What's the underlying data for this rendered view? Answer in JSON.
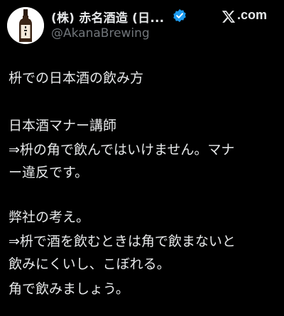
{
  "account": {
    "display_name": "(株) 赤名酒造 (日...",
    "handle": "@AkanaBrewing",
    "verified": true,
    "avatar_icon": "sake-bottle-icon",
    "verified_icon": "verified-badge-icon",
    "verified_color": "#1d9bf0"
  },
  "brand": {
    "logo_icon": "x-logo-icon",
    "logo_text": ".com"
  },
  "post": {
    "lines": [
      "枡での日本酒の飲み方",
      "日本酒マナー講師",
      "⇒枡の角で飲んではいけません。マナ",
      "ー違反です。",
      "弊社の考え。",
      "⇒枡で酒を飲むときは角で飲まないと",
      "飲みにくいし、こぼれる。",
      "角で飲みましょう。"
    ]
  },
  "colors": {
    "background": "#000000",
    "text": "#e7e9ea",
    "secondary_text": "#71767b"
  }
}
